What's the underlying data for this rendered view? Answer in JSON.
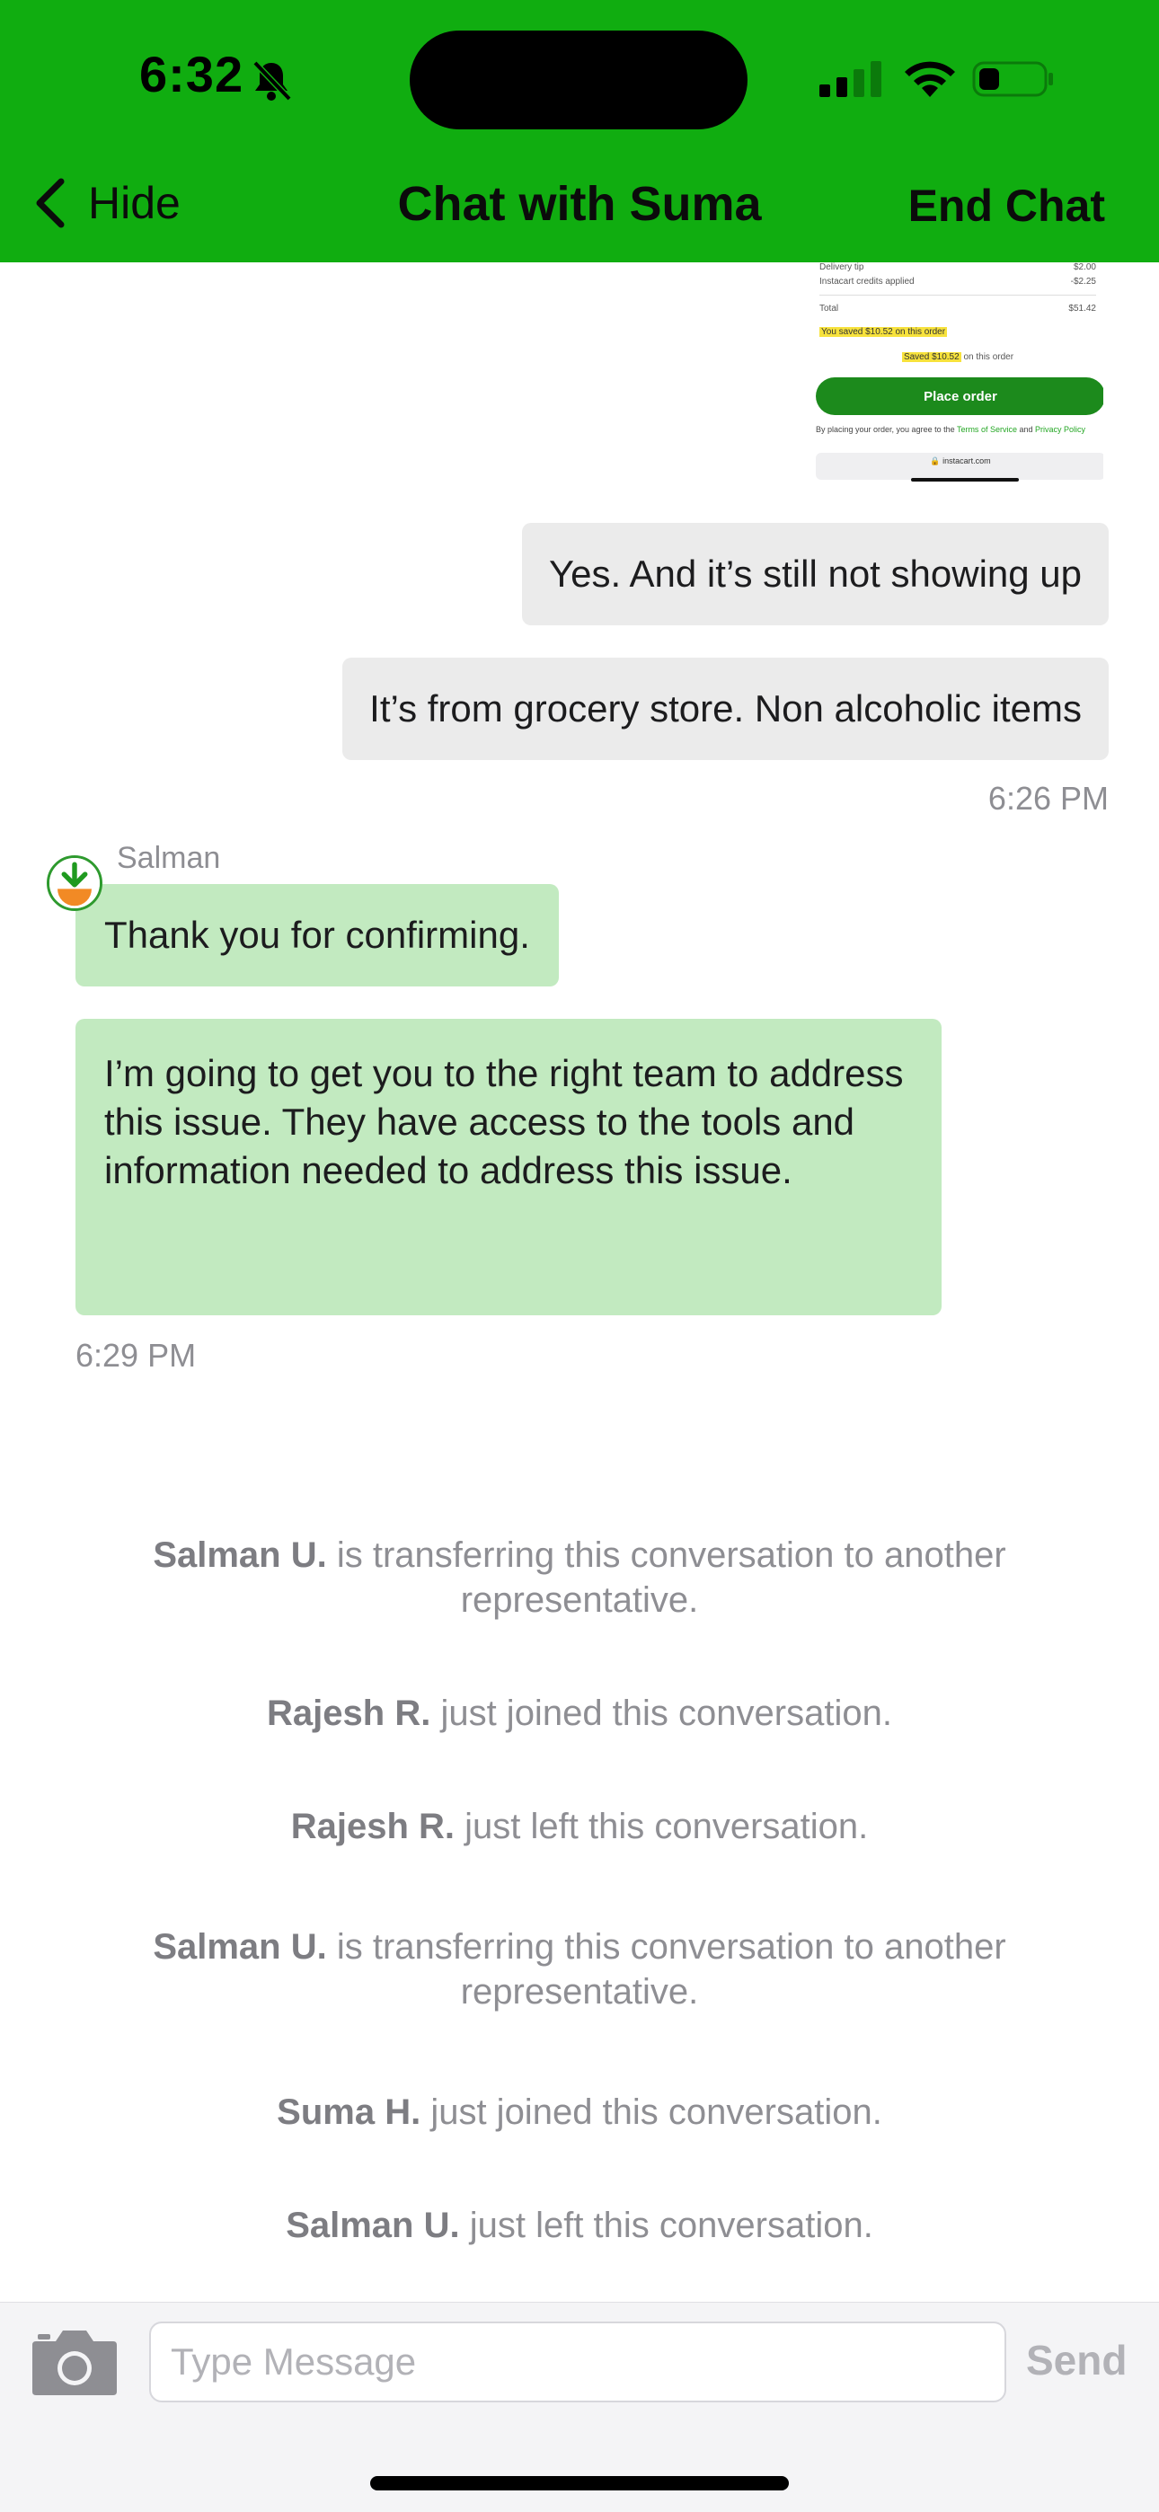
{
  "status_bar": {
    "time": "6:32"
  },
  "nav": {
    "back_label": "Hide",
    "title": "Chat with Suma",
    "end_label": "End Chat"
  },
  "receipt_thumbnail": {
    "rows": [
      {
        "label": "Delivery tip",
        "value": "$2.00"
      },
      {
        "label": "Instacart credits applied",
        "value": "-$2.25"
      },
      {
        "label": "Total",
        "value": "$51.42"
      }
    ],
    "saved_line": "You saved $10.52 on this order",
    "saved_badge": "Saved $10.52",
    "saved_badge_suffix": "on this order",
    "place_order": "Place order",
    "policy_prefix": "By placing your order, you agree to the ",
    "policy_terms": "Terms of Service",
    "policy_and": " and ",
    "policy_privacy": "Privacy Policy",
    "url": "instacart.com"
  },
  "messages": {
    "out_1": "Yes. And it’s still not showing up",
    "out_2": "It’s from grocery store. Non alcoholic items",
    "out_time": "6:26 PM",
    "agent_name": "Salman",
    "in_1": "Thank you for confirming.",
    "in_2": "I’m going to get you to the right team to address this issue. They have access to the tools and information needed to address this issue.",
    "in_time": "6:29 PM"
  },
  "system_messages": [
    {
      "name": "Salman U.",
      "text": " is transferring this conversation to another representative."
    },
    {
      "name": "Rajesh R.",
      "text": " just joined this conversation."
    },
    {
      "name": "Rajesh R.",
      "text": " just left this conversation."
    },
    {
      "name": "Salman U.",
      "text": " is transferring this conversation to another representative."
    },
    {
      "name": "Suma H.",
      "text": " just joined this conversation."
    },
    {
      "name": "Salman U.",
      "text": " just left this conversation."
    }
  ],
  "composer": {
    "placeholder": "Type Message",
    "send_label": "Send"
  },
  "colors": {
    "header_green": "#10ad10",
    "agent_bubble": "#c2eac0",
    "user_bubble": "#ebebeb",
    "muted_text": "#8e8e93"
  },
  "icons": [
    "bell-slash-icon",
    "cellular-signal-icon",
    "wifi-icon",
    "battery-icon",
    "chevron-left-icon",
    "carrot-avatar-icon",
    "camera-icon"
  ]
}
